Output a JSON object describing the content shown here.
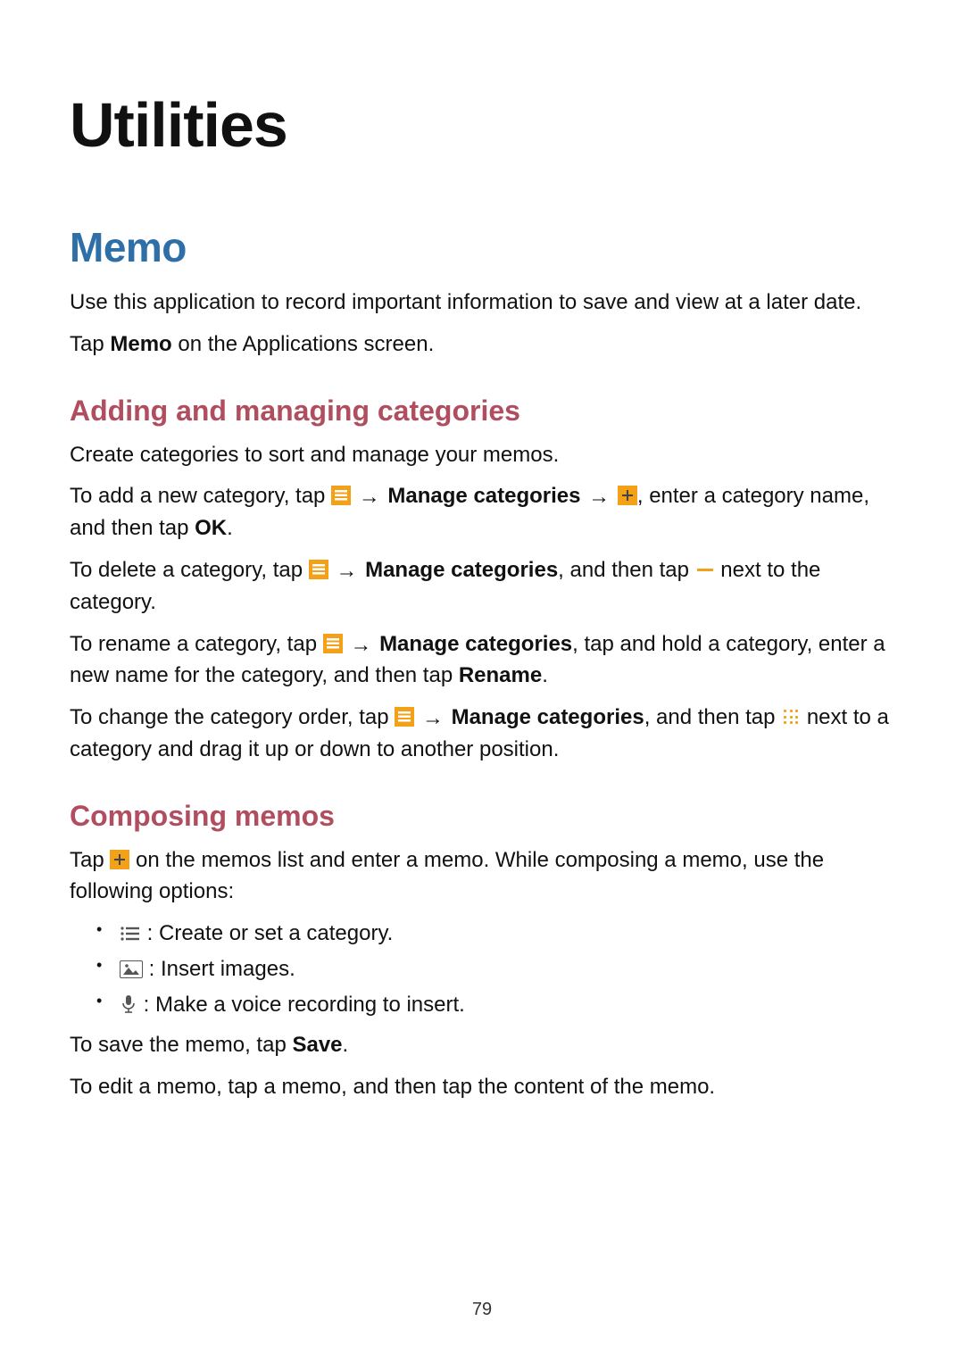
{
  "page_number": "79",
  "chapter_title": "Utilities",
  "section": {
    "title": "Memo",
    "intro1": "Use this application to record important information to save and view at a later date.",
    "intro2_pre": "Tap ",
    "intro2_bold": "Memo",
    "intro2_post": " on the Applications screen."
  },
  "sub1": {
    "title": "Adding and managing categories",
    "p1": "Create categories to sort and manage your memos.",
    "add_pre": "To add a new category, tap ",
    "add_mid1": " → ",
    "add_b1": "Manage categories",
    "add_mid2": " → ",
    "add_post": ", enter a category name, and then tap ",
    "add_ok": "OK",
    "add_end": ".",
    "del_pre": "To delete a category, tap ",
    "del_mid1": " → ",
    "del_b1": "Manage categories",
    "del_post": ", and then tap ",
    "del_end": " next to the category.",
    "ren_pre": "To rename a category, tap ",
    "ren_mid1": " → ",
    "ren_b1": "Manage categories",
    "ren_post": ", tap and hold a category, enter a new name for the category, and then tap ",
    "ren_b2": "Rename",
    "ren_end": ".",
    "ord_pre": "To change the category order, tap ",
    "ord_mid1": " → ",
    "ord_b1": "Manage categories",
    "ord_post": ", and then tap ",
    "ord_end": " next to a category and drag it up or down to another position."
  },
  "sub2": {
    "title": "Composing memos",
    "p1_pre": "Tap ",
    "p1_post": " on the memos list and enter a memo. While composing a memo, use the following options:",
    "bullet1": " : Create or set a category.",
    "bullet2": " : Insert images.",
    "bullet3": " : Make a voice recording to insert.",
    "save_pre": "To save the memo, tap ",
    "save_b": "Save",
    "save_end": ".",
    "edit": "To edit a memo, tap a memo, and then tap the content of the memo."
  },
  "icons": {
    "menu": "menu-icon",
    "plus": "plus-icon",
    "minus": "minus-icon",
    "dots": "drag-handle-icon",
    "list": "category-list-icon",
    "image": "image-icon",
    "mic": "microphone-icon"
  }
}
